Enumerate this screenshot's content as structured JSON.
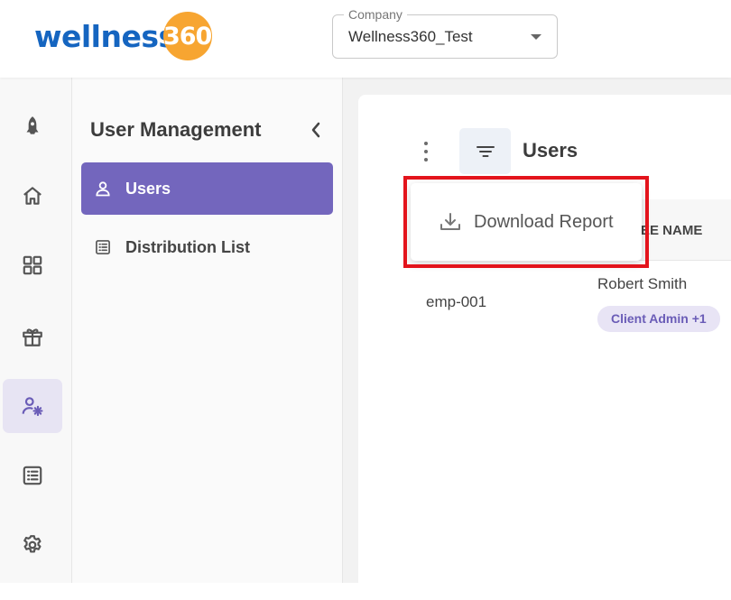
{
  "brand": {
    "logo_text": "wellness",
    "logo_number": "360"
  },
  "company": {
    "label": "Company",
    "value": "Wellness360_Test"
  },
  "rail": {
    "items": [
      {
        "name": "rocket-icon",
        "active": false
      },
      {
        "name": "home-icon",
        "active": false
      },
      {
        "name": "dashboard-grid-icon",
        "active": false
      },
      {
        "name": "gift-icon",
        "active": false
      },
      {
        "name": "user-management-icon",
        "active": true
      },
      {
        "name": "list-icon",
        "active": false
      },
      {
        "name": "settings-icon",
        "active": false
      }
    ]
  },
  "subnav": {
    "title": "User Management",
    "items": [
      {
        "label": "Users",
        "icon": "user-icon",
        "active": true
      },
      {
        "label": "Distribution List",
        "icon": "list-icon",
        "active": false
      }
    ]
  },
  "main": {
    "title": "Users",
    "table": {
      "header_partial": "YEE NAME",
      "rows": [
        {
          "id": "emp-001",
          "name": "Robert Smith",
          "role_badge": "Client Admin +1"
        }
      ]
    }
  },
  "dropdown": {
    "items": [
      {
        "label": "Download Report",
        "icon": "download-icon"
      }
    ]
  },
  "colors": {
    "brand_blue": "#1565c0",
    "brand_orange": "#f7a531",
    "accent_purple": "#7366bd",
    "highlight_red": "#e3141c"
  }
}
